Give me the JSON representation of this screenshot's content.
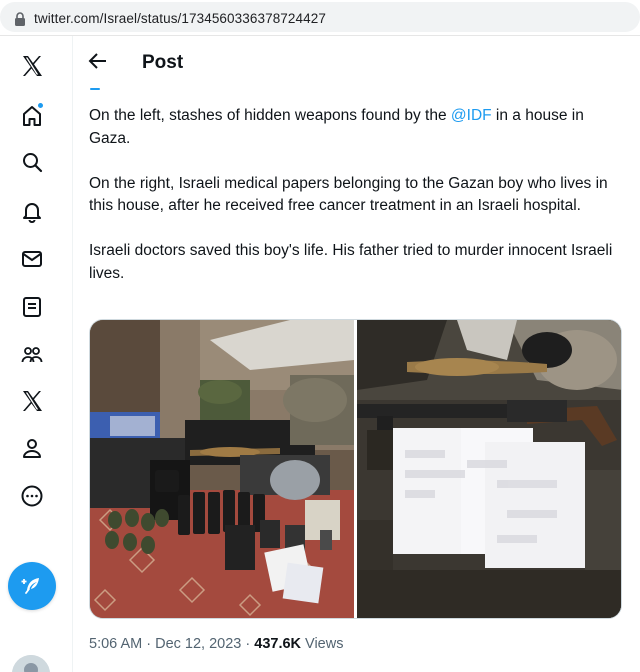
{
  "browser": {
    "url": "twitter.com/Israel/status/1734560336378724427"
  },
  "nav": {
    "items": [
      {
        "name": "x-logo-icon"
      },
      {
        "name": "home-icon"
      },
      {
        "name": "explore-icon"
      },
      {
        "name": "notifications-icon"
      },
      {
        "name": "messages-icon"
      },
      {
        "name": "lists-icon"
      },
      {
        "name": "communities-icon"
      },
      {
        "name": "premium-icon"
      },
      {
        "name": "profile-icon"
      },
      {
        "name": "more-icon"
      }
    ],
    "compose_icon": "compose-feather-icon",
    "accent": "#1d9bf0"
  },
  "header": {
    "title": "Post"
  },
  "tweet": {
    "p1_before": "On the left, stashes of hidden weapons found by the ",
    "p1_mention": "@IDF",
    "p1_after": " in a house in Gaza.",
    "p2": "On the right, Israeli medical papers belonging to the Gazan boy who lives in this house, after he received free cancer treatment in an Israeli hospital.",
    "p3": "Israeli doctors saved this boy's life. His father tried to murder innocent Israeli lives."
  },
  "meta": {
    "time": "5:06 AM",
    "separator": " · ",
    "date": "Dec 12, 2023",
    "views_count": "437.6K",
    "views_label": " Views"
  }
}
